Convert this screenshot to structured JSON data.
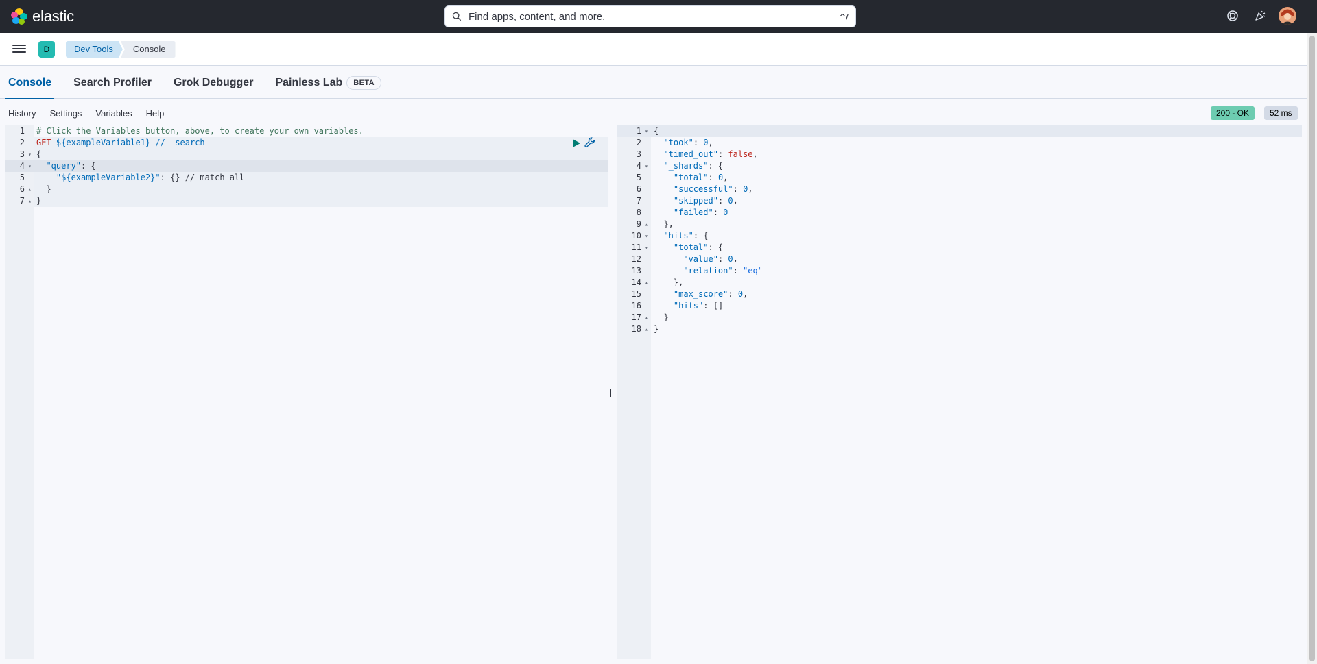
{
  "header": {
    "logo_text": "elastic",
    "search_placeholder": "Find apps, content, and more.",
    "search_shortcut": "^/",
    "icons": [
      "help-icon",
      "newsfeed-icon",
      "user-avatar"
    ]
  },
  "subheader": {
    "space_initial": "D",
    "breadcrumbs": [
      "Dev Tools",
      "Console"
    ]
  },
  "tabs": [
    {
      "label": "Console",
      "active": true
    },
    {
      "label": "Search Profiler"
    },
    {
      "label": "Grok Debugger"
    },
    {
      "label": "Painless Lab",
      "badge": "BETA"
    }
  ],
  "toolbar": {
    "links": [
      "History",
      "Settings",
      "Variables",
      "Help"
    ],
    "status": "200 - OK",
    "timing": "52 ms"
  },
  "request": {
    "lines": [
      {
        "n": "1",
        "fold": ""
      },
      {
        "n": "2",
        "fold": ""
      },
      {
        "n": "3",
        "fold": "▾"
      },
      {
        "n": "4",
        "fold": "▾"
      },
      {
        "n": "5",
        "fold": ""
      },
      {
        "n": "6",
        "fold": "▴"
      },
      {
        "n": "7",
        "fold": "▴"
      }
    ],
    "comment": "# Click the Variables button, above, to create your own variables.",
    "method": "GET",
    "url": "${exampleVariable1} // _search",
    "l3": "{",
    "l4_key": "\"query\"",
    "l4_rest": ": {",
    "l5_key": "\"${exampleVariable2}\"",
    "l5_rest": ": {} // match_all",
    "l6": "}",
    "l7": "}"
  },
  "response": {
    "lines": [
      {
        "n": "1",
        "fold": "▾"
      },
      {
        "n": "2",
        "fold": ""
      },
      {
        "n": "3",
        "fold": ""
      },
      {
        "n": "4",
        "fold": "▾"
      },
      {
        "n": "5",
        "fold": ""
      },
      {
        "n": "6",
        "fold": ""
      },
      {
        "n": "7",
        "fold": ""
      },
      {
        "n": "8",
        "fold": ""
      },
      {
        "n": "9",
        "fold": "▴"
      },
      {
        "n": "10",
        "fold": "▾"
      },
      {
        "n": "11",
        "fold": "▾"
      },
      {
        "n": "12",
        "fold": ""
      },
      {
        "n": "13",
        "fold": ""
      },
      {
        "n": "14",
        "fold": "▴"
      },
      {
        "n": "15",
        "fold": ""
      },
      {
        "n": "16",
        "fold": ""
      },
      {
        "n": "17",
        "fold": "▴"
      },
      {
        "n": "18",
        "fold": "▴"
      }
    ],
    "code": [
      [
        {
          "t": "{",
          "c": "punct",
          "i": 0
        }
      ],
      [
        {
          "t": "\"took\"",
          "c": "key",
          "i": 1
        },
        {
          "t": ": ",
          "c": "punct"
        },
        {
          "t": "0",
          "c": "num"
        },
        {
          "t": ",",
          "c": "punct"
        }
      ],
      [
        {
          "t": "\"timed_out\"",
          "c": "key",
          "i": 1
        },
        {
          "t": ": ",
          "c": "punct"
        },
        {
          "t": "false",
          "c": "bool"
        },
        {
          "t": ",",
          "c": "punct"
        }
      ],
      [
        {
          "t": "\"_shards\"",
          "c": "key",
          "i": 1
        },
        {
          "t": ": {",
          "c": "punct"
        }
      ],
      [
        {
          "t": "\"total\"",
          "c": "key",
          "i": 2
        },
        {
          "t": ": ",
          "c": "punct"
        },
        {
          "t": "0",
          "c": "num"
        },
        {
          "t": ",",
          "c": "punct"
        }
      ],
      [
        {
          "t": "\"successful\"",
          "c": "key",
          "i": 2
        },
        {
          "t": ": ",
          "c": "punct"
        },
        {
          "t": "0",
          "c": "num"
        },
        {
          "t": ",",
          "c": "punct"
        }
      ],
      [
        {
          "t": "\"skipped\"",
          "c": "key",
          "i": 2
        },
        {
          "t": ": ",
          "c": "punct"
        },
        {
          "t": "0",
          "c": "num"
        },
        {
          "t": ",",
          "c": "punct"
        }
      ],
      [
        {
          "t": "\"failed\"",
          "c": "key",
          "i": 2
        },
        {
          "t": ": ",
          "c": "punct"
        },
        {
          "t": "0",
          "c": "num"
        }
      ],
      [
        {
          "t": "},",
          "c": "punct",
          "i": 1
        }
      ],
      [
        {
          "t": "\"hits\"",
          "c": "key",
          "i": 1
        },
        {
          "t": ": {",
          "c": "punct"
        }
      ],
      [
        {
          "t": "\"total\"",
          "c": "key",
          "i": 2
        },
        {
          "t": ": {",
          "c": "punct"
        }
      ],
      [
        {
          "t": "\"value\"",
          "c": "key",
          "i": 3
        },
        {
          "t": ": ",
          "c": "punct"
        },
        {
          "t": "0",
          "c": "num"
        },
        {
          "t": ",",
          "c": "punct"
        }
      ],
      [
        {
          "t": "\"relation\"",
          "c": "key",
          "i": 3
        },
        {
          "t": ": ",
          "c": "punct"
        },
        {
          "t": "\"eq\"",
          "c": "str"
        }
      ],
      [
        {
          "t": "},",
          "c": "punct",
          "i": 2
        }
      ],
      [
        {
          "t": "\"max_score\"",
          "c": "key",
          "i": 2
        },
        {
          "t": ": ",
          "c": "punct"
        },
        {
          "t": "0",
          "c": "num"
        },
        {
          "t": ",",
          "c": "punct"
        }
      ],
      [
        {
          "t": "\"hits\"",
          "c": "key",
          "i": 2
        },
        {
          "t": ": []",
          "c": "punct"
        }
      ],
      [
        {
          "t": "}",
          "c": "punct",
          "i": 1
        }
      ],
      [
        {
          "t": "}",
          "c": "punct",
          "i": 0
        }
      ]
    ]
  },
  "colors": {
    "header_bg": "#25282f",
    "accent": "#0061a6",
    "status_ok": "#6dccb1",
    "space_badge": "#24bbb1"
  }
}
